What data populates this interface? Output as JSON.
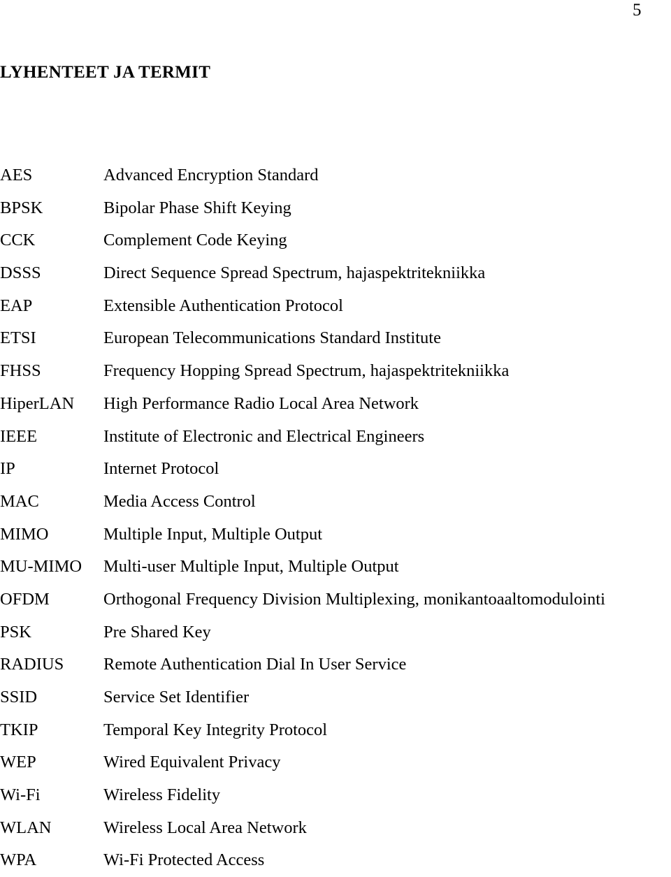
{
  "page": {
    "number": "5",
    "heading": "LYHENTEET JA TERMIT"
  },
  "glossary": {
    "entries": [
      {
        "term": "AES",
        "definition": "Advanced Encryption Standard"
      },
      {
        "term": "BPSK",
        "definition": "Bipolar Phase Shift Keying"
      },
      {
        "term": "CCK",
        "definition": "Complement Code Keying"
      },
      {
        "term": "DSSS",
        "definition": "Direct Sequence Spread Spectrum, hajaspektritekniikka"
      },
      {
        "term": "EAP",
        "definition": "Extensible Authentication Protocol"
      },
      {
        "term": "ETSI",
        "definition": "European Telecommunications Standard Institute"
      },
      {
        "term": "FHSS",
        "definition": "Frequency Hopping Spread Spectrum, hajaspektritekniikka"
      },
      {
        "term": "HiperLAN",
        "definition": "High Performance Radio Local Area Network"
      },
      {
        "term": "IEEE",
        "definition": "Institute of Electronic and Electrical Engineers"
      },
      {
        "term": "IP",
        "definition": "Internet Protocol"
      },
      {
        "term": "MAC",
        "definition": "Media Access Control"
      },
      {
        "term": "MIMO",
        "definition": "Multiple Input, Multiple Output"
      },
      {
        "term": "MU-MIMO",
        "definition": "Multi-user Multiple Input, Multiple Output"
      },
      {
        "term": "OFDM",
        "definition": "Orthogonal Frequency Division Multiplexing, monikantoaaltomodulointi"
      },
      {
        "term": "PSK",
        "definition": "Pre Shared Key"
      },
      {
        "term": "RADIUS",
        "definition": "Remote Authentication Dial In User Service"
      },
      {
        "term": "SSID",
        "definition": "Service Set Identifier"
      },
      {
        "term": "TKIP",
        "definition": "Temporal Key Integrity Protocol"
      },
      {
        "term": "WEP",
        "definition": "Wired Equivalent Privacy"
      },
      {
        "term": "Wi-Fi",
        "definition": "Wireless Fidelity"
      },
      {
        "term": "WLAN",
        "definition": "Wireless Local Area Network"
      },
      {
        "term": "WPA",
        "definition": "Wi-Fi Protected Access"
      }
    ]
  }
}
